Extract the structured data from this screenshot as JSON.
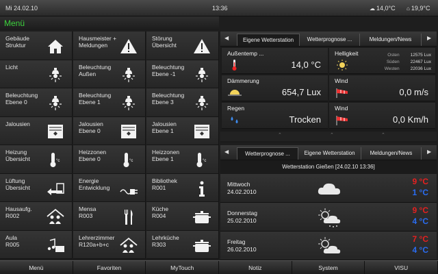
{
  "status": {
    "date": "Mi 24.02.10",
    "time": "13:36",
    "outside_temp": "14,0°C",
    "inside_temp": "19,9°C"
  },
  "menu_title": "Menü",
  "tiles": [
    {
      "label": "Gebäude\nStruktur",
      "icon": "house-icon"
    },
    {
      "label": "Hausmeister +\nMeldungen",
      "icon": "warning-icon"
    },
    {
      "label": "Störung\nÜbersicht",
      "icon": "warning-icon"
    },
    {
      "label": "Licht",
      "icon": "lamp-icon"
    },
    {
      "label": "Beleuchtung\nAußen",
      "icon": "lamp-icon"
    },
    {
      "label": "Beleuchtung\nEbene -1",
      "icon": "lamp-icon"
    },
    {
      "label": "Beleuchtung\nEbene 0",
      "icon": "lamp-icon"
    },
    {
      "label": "Beleuchtung\nEbene 1",
      "icon": "lamp-icon"
    },
    {
      "label": "Beleuchtung\nEbene 3",
      "icon": "lamp-icon"
    },
    {
      "label": "Jalousien",
      "icon": "blind-icon"
    },
    {
      "label": "Jalousien\nEbene 0",
      "icon": "blind-icon"
    },
    {
      "label": "Jalousien\nEbene 1",
      "icon": "blind-icon"
    },
    {
      "label": "Heizung\nÜbersicht",
      "icon": "thermometer-icon"
    },
    {
      "label": "Heizzonen\nEbene 0",
      "icon": "thermometer-icon"
    },
    {
      "label": "Heizzonen\nEbene 1",
      "icon": "thermometer-icon"
    },
    {
      "label": "Lüftung\nÜbersicht",
      "icon": "ventilation-icon"
    },
    {
      "label": "Energie\nEntwicklung",
      "icon": "plug-icon"
    },
    {
      "label": "Bibliothek\nR001",
      "icon": "info-icon"
    },
    {
      "label": "Hausaufg.\nR002",
      "icon": "people-house-icon"
    },
    {
      "label": "Mensa\nR003",
      "icon": "cutlery-icon"
    },
    {
      "label": "Küche\nR004",
      "icon": "pot-icon"
    },
    {
      "label": "Aula\nR005",
      "icon": "music-icon"
    },
    {
      "label": "Lehrerzimmer\nR120a+b+c",
      "icon": "people-house-icon"
    },
    {
      "label": "Lehrküche\nR303",
      "icon": "pot-icon"
    }
  ],
  "panel1": {
    "tabs": [
      "Eigene Wetterstation",
      "Wetterprognose ...",
      "Meldungen/News"
    ],
    "cells": {
      "aussentemp": {
        "label": "Außentemp ...",
        "value": "14,0 °C"
      },
      "helligkeit": {
        "label": "Helligkeit",
        "rows": [
          {
            "name": "Osten",
            "value": "12575 Lux"
          },
          {
            "name": "Süden",
            "value": "22467 Lux"
          },
          {
            "name": "Westen",
            "value": "22036 Lux"
          }
        ]
      },
      "daemmerung": {
        "label": "Dämmerung",
        "value": "654,7 Lux"
      },
      "wind1": {
        "label": "Wind",
        "value": "0,0 m/s"
      },
      "regen": {
        "label": "Regen",
        "value": "Trocken"
      },
      "wind2": {
        "label": "Wind",
        "value": "0,0 Km/h"
      }
    }
  },
  "panel2": {
    "tabs": [
      "Wetterprognose ...",
      "Eigene Wetterstation",
      "Meldungen/News"
    ],
    "header": "Wetterstation Gießen  [24.02.10 13:36]",
    "days": [
      {
        "day": "Mittwoch",
        "date": "24.02.2010",
        "high": "9 °C",
        "low": "1 °C",
        "icon": "cloud-icon"
      },
      {
        "day": "Donnerstag",
        "date": "25.02.2010",
        "high": "9 °C",
        "low": "4 °C",
        "icon": "sun-cloud-rain-icon"
      },
      {
        "day": "Freitag",
        "date": "26.02.2010",
        "high": "7 °C",
        "low": "4 °C",
        "icon": "sun-cloud-icon"
      }
    ]
  },
  "bottom_nav": [
    "Menü",
    "Favoriten",
    "MyTouch",
    "Notiz",
    "System",
    "VISU"
  ]
}
